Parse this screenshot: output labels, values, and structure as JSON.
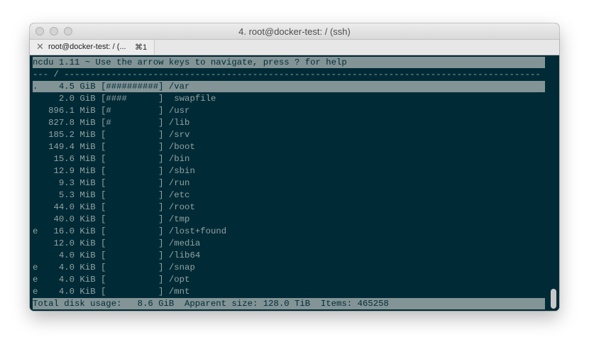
{
  "window": {
    "title": "4. root@docker-test: / (ssh)"
  },
  "tabs": [
    {
      "label": "root@docker-test: / (...",
      "shortcut": "⌘1"
    }
  ],
  "icons": {
    "close": "close-icon",
    "traffic": [
      "close-window-icon",
      "minimize-window-icon",
      "zoom-window-icon"
    ]
  },
  "colors": {
    "terminal_bg": "#002b36",
    "highlight_bg": "#839496",
    "text": "#93a1a1"
  },
  "header": "ncdu 1.11 ~ Use the arrow keys to navigate, press ? for help",
  "path_line": "--- / -------------------------------------------------------------------------------------------",
  "entries": [
    {
      "flag": ".",
      "size": "  4.5 GiB",
      "bar": "[##########]",
      "name": "/var"
    },
    {
      "flag": " ",
      "size": "  2.0 GiB",
      "bar": "[####      ]",
      "name": " swapfile"
    },
    {
      "flag": " ",
      "size": "896.1 MiB",
      "bar": "[#         ]",
      "name": "/usr"
    },
    {
      "flag": " ",
      "size": "827.8 MiB",
      "bar": "[#         ]",
      "name": "/lib"
    },
    {
      "flag": " ",
      "size": "185.2 MiB",
      "bar": "[          ]",
      "name": "/srv"
    },
    {
      "flag": " ",
      "size": "149.4 MiB",
      "bar": "[          ]",
      "name": "/boot"
    },
    {
      "flag": " ",
      "size": " 15.6 MiB",
      "bar": "[          ]",
      "name": "/bin"
    },
    {
      "flag": " ",
      "size": " 12.9 MiB",
      "bar": "[          ]",
      "name": "/sbin"
    },
    {
      "flag": " ",
      "size": "  9.3 MiB",
      "bar": "[          ]",
      "name": "/run"
    },
    {
      "flag": " ",
      "size": "  5.3 MiB",
      "bar": "[          ]",
      "name": "/etc"
    },
    {
      "flag": " ",
      "size": " 44.0 KiB",
      "bar": "[          ]",
      "name": "/root"
    },
    {
      "flag": " ",
      "size": " 40.0 KiB",
      "bar": "[          ]",
      "name": "/tmp"
    },
    {
      "flag": "e",
      "size": " 16.0 KiB",
      "bar": "[          ]",
      "name": "/lost+found"
    },
    {
      "flag": " ",
      "size": " 12.0 KiB",
      "bar": "[          ]",
      "name": "/media"
    },
    {
      "flag": " ",
      "size": "  4.0 KiB",
      "bar": "[          ]",
      "name": "/lib64"
    },
    {
      "flag": "e",
      "size": "  4.0 KiB",
      "bar": "[          ]",
      "name": "/snap"
    },
    {
      "flag": "e",
      "size": "  4.0 KiB",
      "bar": "[          ]",
      "name": "/opt"
    },
    {
      "flag": "e",
      "size": "  4.0 KiB",
      "bar": "[          ]",
      "name": "/mnt"
    }
  ],
  "status": {
    "total_label": "Total disk usage:",
    "total_value": "8.6 GiB",
    "apparent_label": "Apparent size:",
    "apparent_value": "128.0 TiB",
    "items_label": "Items:",
    "items_value": "465258"
  }
}
